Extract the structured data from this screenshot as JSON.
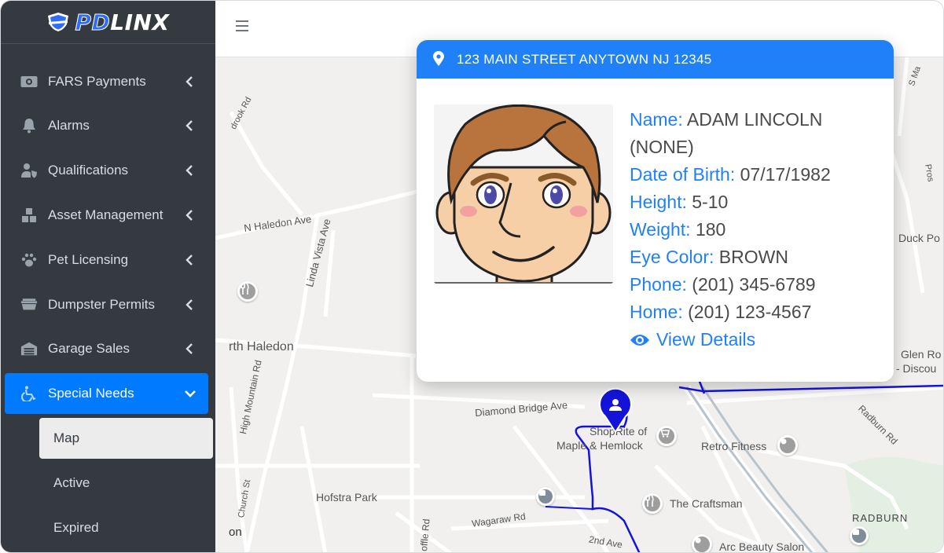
{
  "brand": {
    "pd": "PD",
    "linx": "LINX"
  },
  "sidebar": {
    "items": [
      {
        "label": "FARS Payments",
        "icon": "money-icon"
      },
      {
        "label": "Alarms",
        "icon": "bell-icon"
      },
      {
        "label": "Qualifications",
        "icon": "user-shield-icon"
      },
      {
        "label": "Asset Management",
        "icon": "boxes-icon"
      },
      {
        "label": "Pet Licensing",
        "icon": "paw-icon"
      },
      {
        "label": "Dumpster Permits",
        "icon": "dumpster-icon"
      },
      {
        "label": "Garage Sales",
        "icon": "warehouse-icon"
      },
      {
        "label": "Special Needs",
        "icon": "wheelchair-icon",
        "active": true
      }
    ],
    "subitems": [
      {
        "label": "Map",
        "selected": true
      },
      {
        "label": "Active"
      },
      {
        "label": "Expired"
      }
    ]
  },
  "map": {
    "labels": {
      "n_haledon_ave": "N Haledon Ave",
      "linda_vista_ave": "Linda Vista Ave",
      "north_haledon": "rth Haledon",
      "high_mountain_rd": "High Mountain Rd",
      "diamond_bridge_ave": "Diamond Bridge Ave",
      "shoprite_line1": "ShopRite of",
      "shoprite_line2": "Maple & Hemlock",
      "retro_fitness": "Retro Fitness",
      "hofstra_park": "Hofstra Park",
      "the_craftsman": "The Craftsman",
      "wagaraw_rd": "Wagaraw Rd",
      "second_ave": "2nd Ave",
      "radburn": "RADBURN",
      "arc_beauty_salon": "Arc Beauty Salon",
      "radburn_rd": "Radburn Rd",
      "glen_ro": "Glen Ro",
      "discour": "- Discou",
      "duck_po": "Duck Po",
      "church_st": "Church St",
      "goffle_rd": "offle Rd",
      "rock_rd": "drook Rd",
      "on": "on",
      "s_ma": "S Ma",
      "pros": "Pros"
    }
  },
  "popup": {
    "address": "123 MAIN STREET ANYTOWN NJ 12345",
    "name_label": "Name:",
    "name_value": "ADAM LINCOLN",
    "alias": "(NONE)",
    "dob_label": "Date of Birth:",
    "dob_value": "07/17/1982",
    "height_label": "Height:",
    "height_value": "5-10",
    "weight_label": "Weight:",
    "weight_value": "180",
    "eye_label": "Eye Color:",
    "eye_value": "BROWN",
    "phone_label": "Phone:",
    "phone_value": "(201) 345-6789",
    "home_label": "Home:",
    "home_value": "(201) 123-4567",
    "view_details": "View Details"
  },
  "colors": {
    "accent": "#1f80f7",
    "sidebar_bg": "#343a40",
    "marker": "#1414d9"
  }
}
